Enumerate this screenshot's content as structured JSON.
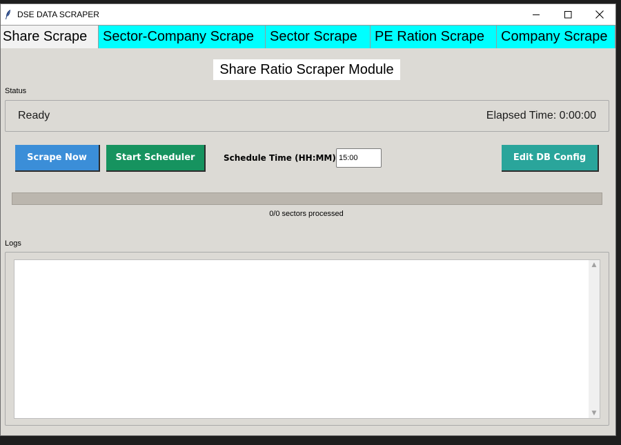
{
  "window": {
    "title": "DSE DATA SCRAPER",
    "app_icon": "feather-icon",
    "controls": [
      "minimize-icon",
      "maximize-icon",
      "close-icon"
    ]
  },
  "tabs": [
    {
      "label": "Share Scrape",
      "active": true
    },
    {
      "label": "Sector-Company Scrape",
      "active": false
    },
    {
      "label": "Sector Scrape",
      "active": false
    },
    {
      "label": "PE Ration Scrape",
      "active": false
    },
    {
      "label": "Company Scrape",
      "active": false
    }
  ],
  "main": {
    "module_title": "Share Ratio Scraper Module",
    "status_label": "Status",
    "status_text": "Ready",
    "elapsed_text": "Elapsed Time: 0:00:00",
    "buttons": {
      "scrape_now": "Scrape Now",
      "start_scheduler": "Start Scheduler",
      "edit_db_config": "Edit DB Config"
    },
    "schedule_label": "Schedule Time (HH:MM):",
    "schedule_value": "15:00",
    "progress": {
      "value": 0,
      "text": "0/0 sectors processed"
    },
    "logs_label": "Logs",
    "logs_content": ""
  },
  "colors": {
    "window_bg": "#dcdad5",
    "tab_accent": "#00ffff",
    "scrape_button": "#3b8ed8",
    "scheduler_button": "#16935f",
    "db_button": "#2aa59b",
    "progress_track": "#bbb6ae"
  }
}
